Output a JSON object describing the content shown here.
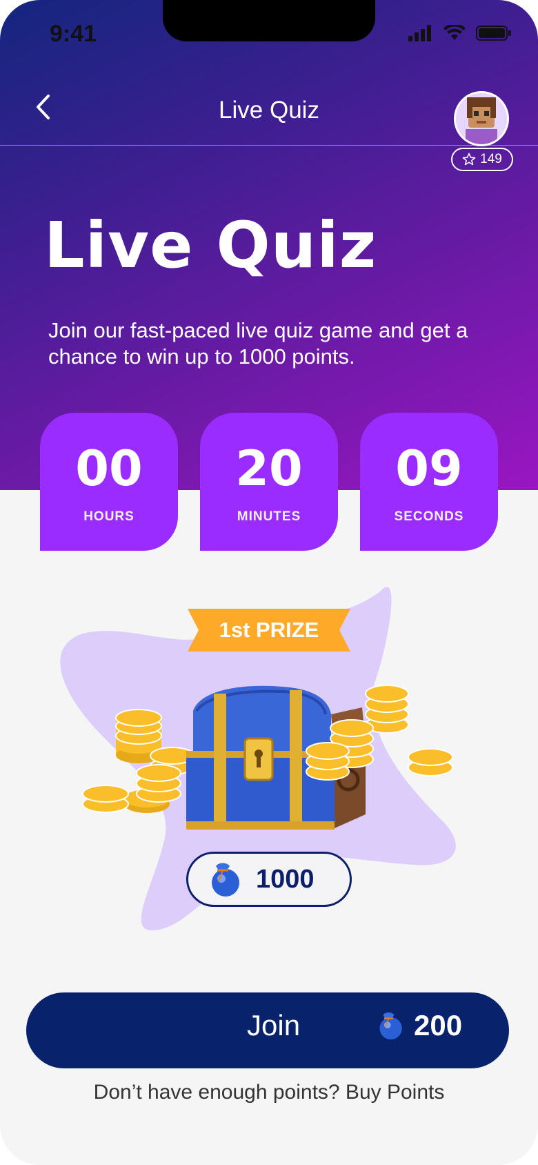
{
  "status_bar": {
    "time": "9:41"
  },
  "header": {
    "title": "Live Quiz",
    "points": "149"
  },
  "hero": {
    "heading": "Live Quiz",
    "description": "Join our fast-paced live quiz game and get a chance to win up to 1000 points."
  },
  "countdown": [
    {
      "value": "00",
      "label": "HOURS"
    },
    {
      "value": "20",
      "label": "MINUTES"
    },
    {
      "value": "09",
      "label": "SECONDS"
    }
  ],
  "prize": {
    "ribbon": "1st PRIZE",
    "value": "1000"
  },
  "join": {
    "label": "Join",
    "cost": "200"
  },
  "footer": {
    "buy_text": "Don’t have enough points? Buy Points"
  },
  "colors": {
    "hero_gradient_start": "#14267e",
    "hero_gradient_end": "#9a16c2",
    "countdown_box": "#9b2cff",
    "ribbon": "#ffa928",
    "blob": "#dccdfb",
    "join_button": "#08226b",
    "coin": "#f9be2a"
  },
  "icons": {
    "back": "chevron-left-icon",
    "points": "star-icon",
    "currency": "blue-bag-icon"
  }
}
